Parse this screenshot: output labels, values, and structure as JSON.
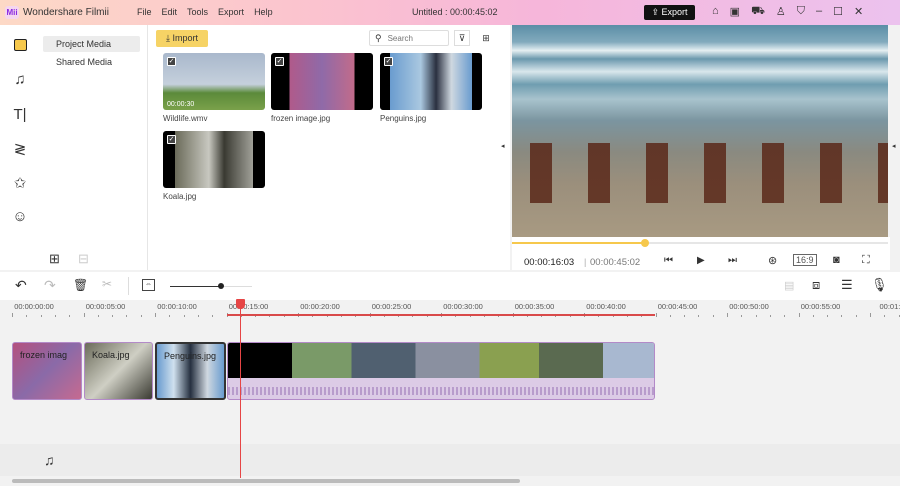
{
  "titlebar": {
    "app": "Wondershare Filmii",
    "logo": "Mii",
    "menu": [
      "File",
      "Edit",
      "Tools",
      "Export",
      "Help"
    ],
    "project": "Untitled :  00:00:45:02",
    "export": "Export",
    "icons": [
      "home-icon",
      "save-icon",
      "cart-icon",
      "user-icon",
      "shirt-icon",
      "minimize-icon",
      "maximize-icon",
      "close-icon"
    ]
  },
  "sidebar": {
    "icons": [
      "folder-icon",
      "music-icon",
      "text-icon",
      "transition-icon",
      "effects-icon",
      "sticker-icon"
    ],
    "items": [
      {
        "label": "Project Media",
        "active": true
      },
      {
        "label": "Shared Media",
        "active": false
      }
    ]
  },
  "media": {
    "import": "Import",
    "search_placeholder": "Search",
    "items": [
      {
        "name": "Wildlife.wmv",
        "duration": "00:00:30"
      },
      {
        "name": "frozen image.jpg"
      },
      {
        "name": "Penguins.jpg"
      },
      {
        "name": "Koala.jpg"
      }
    ]
  },
  "player": {
    "current": "00:00:16:03",
    "total": "00:00:45:02",
    "ratio": "16:9",
    "progress": 0.355,
    "accent": "#f6c84c"
  },
  "timeline": {
    "ticks": [
      "00:00:00:00",
      "00:00:05:00",
      "00:00:10:00",
      "00:00:15:00",
      "00:00:20:00",
      "00:00:25:00",
      "00:00:30:00",
      "00:00:35:00",
      "00:00:40:00",
      "00:00:45:00",
      "00:00:50:00",
      "00:00:55:00",
      "00:01:0"
    ],
    "clips": [
      "frozen imag",
      "Koala.jpg",
      "Penguins.jpg"
    ],
    "playhead": "00:00:16:03",
    "playhead_color": "#e64545"
  }
}
